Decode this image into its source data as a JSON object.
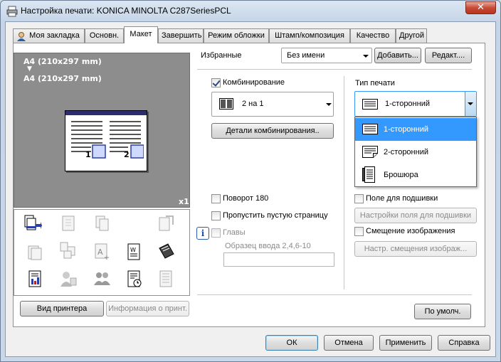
{
  "window": {
    "title": "Настройка печати: KONICA MINOLTA C287SeriesPCL",
    "close_label": "✕"
  },
  "tabs": [
    {
      "label": "Моя закладка",
      "active": false
    },
    {
      "label": "Основн.",
      "active": false
    },
    {
      "label": "Макет",
      "active": true
    },
    {
      "label": "Завершить",
      "active": false
    },
    {
      "label": "Режим обложки",
      "active": false
    },
    {
      "label": "Штамп/композиция",
      "active": false
    },
    {
      "label": "Качество",
      "active": false
    },
    {
      "label": "Другой",
      "active": false
    }
  ],
  "preview": {
    "line1": "A4 (210x297 mm)",
    "arrow": "▼",
    "line2": "A4 (210x297 mm)",
    "copies": "x1",
    "page1": "1",
    "page2": "2"
  },
  "favorites": {
    "label": "Избранные",
    "value": "Без имени",
    "add_button": "Добавить...",
    "edit_button": "Редакт...."
  },
  "combine": {
    "checkbox_label": "Комбинирование",
    "checked": true,
    "value": "2 на 1",
    "details_button": "Детали комбинирования.."
  },
  "print_type": {
    "label": "Тип печати",
    "value": "1-сторонний",
    "options": [
      "1-сторонний",
      "2-сторонний",
      "Брошюра"
    ],
    "selected_index": 0
  },
  "options_left": {
    "rotate": "Поворот 180",
    "skip_blank": "Пропустить пустую страницу",
    "chapters": "Главы",
    "chapters_hint": "Образец ввода 2,4,6-10",
    "chapters_value": ""
  },
  "options_right": {
    "binding_margin": "Поле для подшивки",
    "binding_settings_button": "Настройки поля для подшивки",
    "image_shift": "Смещение изображения",
    "image_shift_button": "Настр. смещения изображ..."
  },
  "bottom_panel": {
    "printer_view_button": "Вид принтера",
    "printer_info_button": "Информация о принт.",
    "default_button": "По умолч."
  },
  "dialog_buttons": {
    "ok": "ОК",
    "cancel": "Отмена",
    "apply": "Применить",
    "help": "Справка"
  },
  "colors": {
    "accent": "#3399ff",
    "highlight": "#0078d7",
    "preview_bg": "#8d8d8d"
  }
}
